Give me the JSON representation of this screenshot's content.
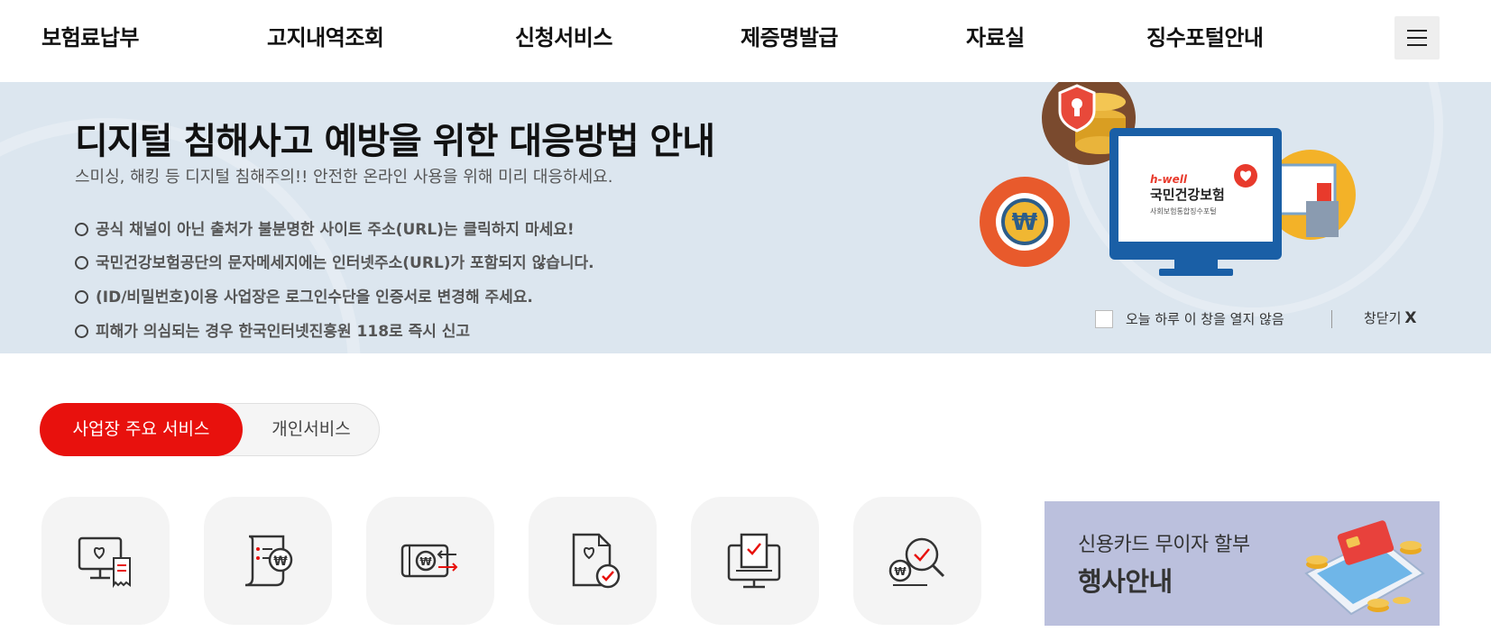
{
  "nav": {
    "items": [
      "보험료납부",
      "고지내역조회",
      "신청서비스",
      "제증명발급",
      "자료실",
      "징수포털안내"
    ]
  },
  "banner": {
    "title": "디지털 침해사고 예방을 위한 대응방법 안내",
    "subtitle": "스미싱, 해킹 등 디지털 침해주의!! 안전한 온라인 사용을 위해 미리 대응하세요.",
    "items": [
      "공식 채널이 아닌 출처가 불분명한 사이트 주소(URL)는 클릭하지 마세요!",
      "국민건강보험공단의 문자메세지에는 인터넷주소(URL)가 포함되지 않습니다.",
      "(ID/비밀번호)이용 사업장은 로그인수단을 인증서로 변경해 주세요.",
      "피해가 의심되는 경우 한국인터넷진흥원 118로 즉시 신고"
    ],
    "monitor": {
      "brand": "h-well",
      "name": "국민건강보험",
      "caption": "사회보험통합징수포털"
    },
    "today_label": "오늘 하루 이 창을 열지 않음",
    "close_label": "창닫기",
    "close_mark": "X"
  },
  "tabs": {
    "active": "사업장 주요 서비스",
    "other": "개인서비스"
  },
  "services": {
    "icons": [
      "monitor-heart-receipt-icon",
      "document-won-icon",
      "card-won-transfer-icon",
      "document-heart-check-icon",
      "monitor-check-icon",
      "won-search-check-icon"
    ]
  },
  "promo": {
    "line1": "신용카드 무이자 할부",
    "line2": "행사안내"
  },
  "colors": {
    "accent": "#e8110d",
    "banner_bg": "#dce6ef",
    "card_bg": "#f4f4f4",
    "promo_bg": "#bbc0dd"
  }
}
